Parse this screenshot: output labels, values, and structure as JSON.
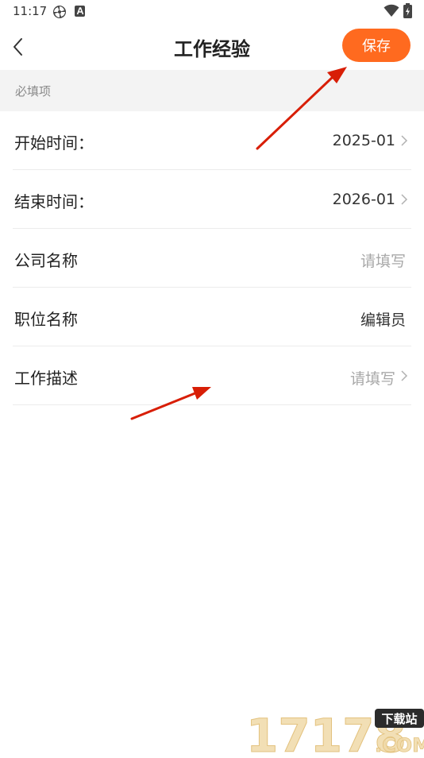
{
  "status_bar": {
    "time": "11:17",
    "icons": [
      "pinwheel-icon",
      "a-letter-icon",
      "wifi-icon",
      "battery-charging-icon"
    ]
  },
  "header": {
    "title": "工作经验",
    "back_icon": "back-chevron-icon",
    "save_label": "保存",
    "accent_color": "#ff6a1f"
  },
  "section": {
    "label": "必填项"
  },
  "form": {
    "rows": [
      {
        "label": "开始时间：",
        "value": "2025-01",
        "placeholder": false,
        "chevron": true
      },
      {
        "label": "结束时间：",
        "value": "2026-01",
        "placeholder": false,
        "chevron": true
      },
      {
        "label": "公司名称",
        "value": "请填写",
        "placeholder": true,
        "chevron": false
      },
      {
        "label": "职位名称",
        "value": "编辑员",
        "placeholder": false,
        "chevron": false
      },
      {
        "label": "工作描述",
        "value": "请填写",
        "placeholder": true,
        "chevron": true
      }
    ]
  },
  "watermark": {
    "text": "17178",
    "badge": "下载站",
    "suffix": ".COM"
  }
}
